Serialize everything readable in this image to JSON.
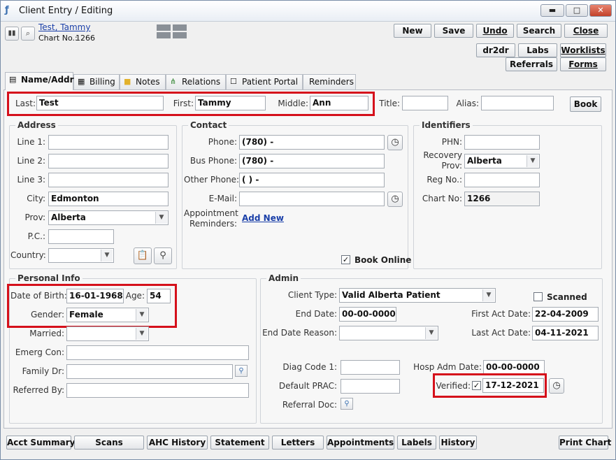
{
  "window": {
    "title": "Client Entry / Editing",
    "controls": {
      "minimize": "▬",
      "maximize": "□",
      "close": "✕"
    }
  },
  "header": {
    "patient_name": "Test, Tammy",
    "chart_no_label": "Chart No.:",
    "chart_no_value": "1266"
  },
  "toolbar": {
    "new": "New",
    "save": "Save",
    "undo": "Undo",
    "search": "Search",
    "close": "Close",
    "dr2dr": "dr2dr",
    "labs": "Labs",
    "worklists": "Worklists",
    "referrals": "Referrals",
    "forms": "Forms"
  },
  "tabs": [
    {
      "label": "Name/Addr",
      "icon": "id-card-icon"
    },
    {
      "label": "Billing",
      "icon": "calculator-icon"
    },
    {
      "label": "Notes",
      "icon": "folder-icon"
    },
    {
      "label": "Relations",
      "icon": "org-chart-icon"
    },
    {
      "label": "Patient Portal",
      "icon": "person-portrait-icon"
    },
    {
      "label": "Reminders",
      "icon": ""
    }
  ],
  "name": {
    "last_label": "Last:",
    "last": "Test",
    "first_label": "First:",
    "first": "Tammy",
    "middle_label": "Middle:",
    "middle": "Ann",
    "title_label": "Title:",
    "title": "",
    "alias_label": "Alias:",
    "alias": "",
    "book_button": "Book"
  },
  "address": {
    "group_title": "Address",
    "line1_label": "Line 1:",
    "line1": "",
    "line2_label": "Line 2:",
    "line2": "",
    "line3_label": "Line 3:",
    "line3": "",
    "city_label": "City:",
    "city": "Edmonton",
    "prov_label": "Prov:",
    "prov": "Alberta",
    "pc_label": "P.C.:",
    "pc": "",
    "country_label": "Country:",
    "country": ""
  },
  "contact": {
    "group_title": "Contact",
    "phone_label": "Phone:",
    "phone": "(780)  -",
    "bus_phone_label": "Bus Phone:",
    "bus_phone": "(780)  -",
    "other_phone_label": "Other Phone:",
    "other_phone": "(  )  -",
    "email_label": "E-Mail:",
    "email": "",
    "appt_reminders_label_1": "Appointment",
    "appt_reminders_label_2": "Reminders:",
    "add_new": "Add New",
    "book_online_label": "Book Online",
    "book_online_checked": "✓"
  },
  "identifiers": {
    "group_title": "Identifiers",
    "phn_label": "PHN:",
    "phn": "",
    "recovery_label_1": "Recovery",
    "recovery_label_2": "Prov:",
    "recovery_prov": "Alberta",
    "reg_no_label": "Reg No.:",
    "reg_no": "",
    "chart_no_label": "Chart No:",
    "chart_no": "1266"
  },
  "personal_info": {
    "group_title": "Personal Info",
    "dob_label": "Date of Birth:",
    "dob": "16-01-1968",
    "age_label": "Age:",
    "age": "54",
    "gender_label": "Gender:",
    "gender": "Female",
    "married_label": "Married:",
    "married": "",
    "emerg_con_label": "Emerg Con:",
    "emerg_con": "",
    "family_dr_label": "Family Dr:",
    "family_dr": "",
    "referred_by_label": "Referred By:",
    "referred_by": ""
  },
  "admin": {
    "group_title": "Admin",
    "client_type_label": "Client Type:",
    "client_type": "Valid Alberta Patient",
    "scanned_label": "Scanned",
    "end_date_label": "End Date:",
    "end_date": "00-00-0000",
    "first_act_date_label": "First Act Date:",
    "first_act_date": "22-04-2009",
    "end_date_reason_label": "End Date Reason:",
    "end_date_reason": "",
    "last_act_date_label": "Last Act Date:",
    "last_act_date": "04-11-2021",
    "diag_code_label": "Diag Code 1:",
    "diag_code": "",
    "hosp_adm_date_label": "Hosp Adm Date:",
    "hosp_adm_date": "00-00-0000",
    "default_prac_label": "Default PRAC:",
    "default_prac": "",
    "verified_label": "Verified:",
    "verified_checked": "✓",
    "verified_date": "17-12-2021",
    "referral_doc_label": "Referral Doc:"
  },
  "bottom_bar": {
    "acct_summary": "Acct Summary",
    "scans": "Scans",
    "ahc_history": "AHC History",
    "statement": "Statement",
    "letters": "Letters",
    "appointments": "Appointments",
    "labels": "Labels",
    "history": "History",
    "print_chart": "Print Chart"
  },
  "colors": {
    "highlight_red": "#d5101b",
    "link_blue": "#1a3fa8"
  }
}
